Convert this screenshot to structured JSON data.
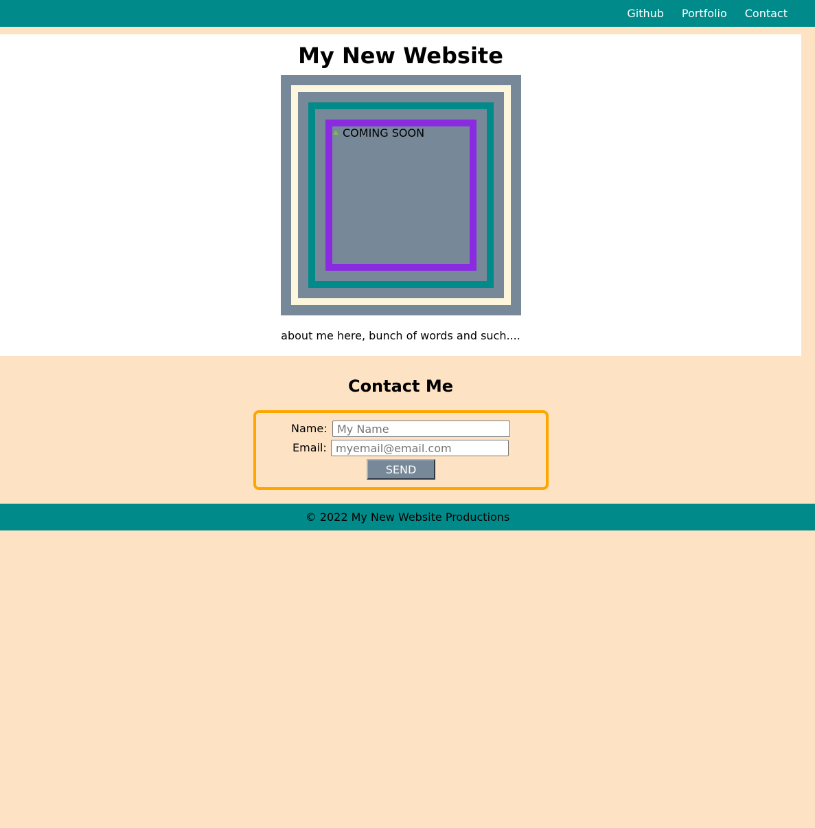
{
  "nav": {
    "items": [
      {
        "label": "Github"
      },
      {
        "label": "Portfolio"
      },
      {
        "label": "Contact"
      }
    ]
  },
  "hero": {
    "title": "My New Website",
    "image_alt": "COMING SOON",
    "about": "about me here, bunch of words and such...."
  },
  "contact": {
    "title": "Contact Me",
    "name_label": "Name:",
    "name_placeholder": "My Name",
    "email_label": "Email:",
    "email_placeholder": "myemail@email.com",
    "send_label": "SEND"
  },
  "footer": {
    "text": "© 2022 My New Website Productions"
  },
  "colors": {
    "header_teal": "#008b8a",
    "page_bg": "#fde3c3",
    "frame_slate": "#778899",
    "frame_cream": "#fdf6dd",
    "frame_purple": "#8a2be2",
    "form_border": "#ffa500"
  }
}
